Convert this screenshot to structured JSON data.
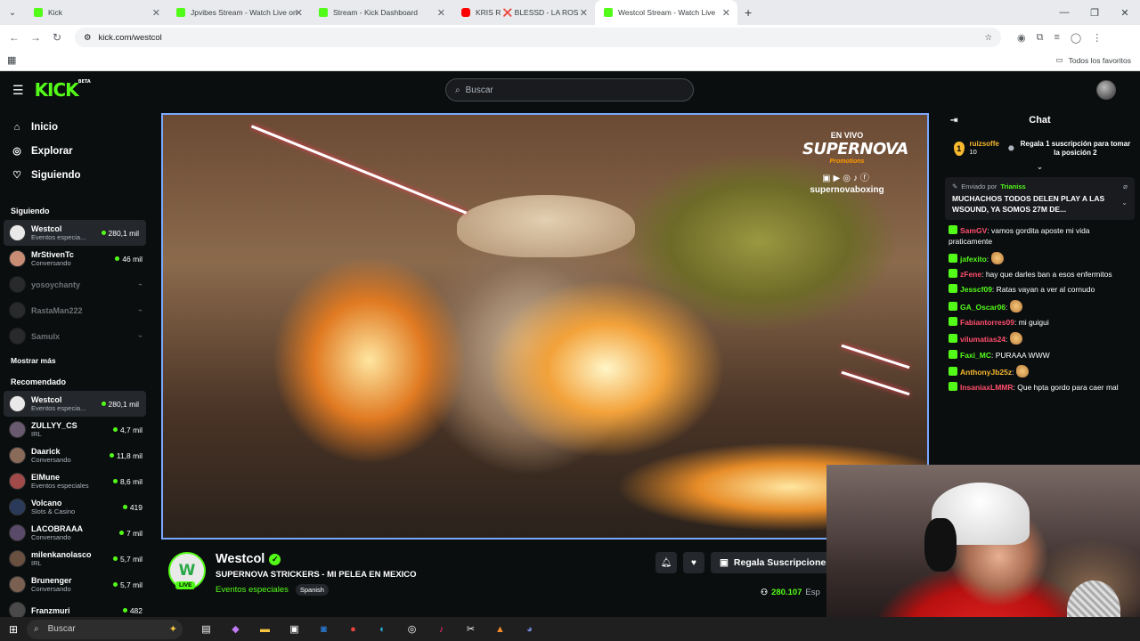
{
  "browser": {
    "tabs": [
      {
        "title": "Kick",
        "favicon": "kick-icon",
        "active": false
      },
      {
        "title": "Jpvibes Stream - Watch Live on",
        "favicon": "kick-icon",
        "active": false
      },
      {
        "title": "Stream - Kick Dashboard",
        "favicon": "kick-icon",
        "active": false
      },
      {
        "title": "KRIS R ❌ BLESSD - LA ROS",
        "favicon": "youtube-icon",
        "active": false
      },
      {
        "title": "Westcol Stream - Watch Live",
        "favicon": "kick-icon",
        "active": true
      }
    ],
    "url": "kick.com/westcol",
    "bookmarks_label": "Todos los favoritos"
  },
  "header": {
    "logo_text": "KICK",
    "logo_badge": "BETA",
    "search_placeholder": "Buscar"
  },
  "sidebar": {
    "nav": [
      {
        "label": "Inicio",
        "icon": "home-icon"
      },
      {
        "label": "Explorar",
        "icon": "compass-icon"
      },
      {
        "label": "Siguiendo",
        "icon": "heart-icon"
      }
    ],
    "following_title": "Siguiendo",
    "following": [
      {
        "name": "Westcol",
        "sub": "Eventos especia...",
        "viewers": "280,1 mil",
        "live": true
      },
      {
        "name": "MrStivenTc",
        "sub": "Conversando",
        "viewers": "46 mil",
        "live": true
      },
      {
        "name": "yosoychanty",
        "sub": "",
        "viewers": "",
        "live": false
      },
      {
        "name": "RastaMan222",
        "sub": "",
        "viewers": "",
        "live": false
      },
      {
        "name": "Samulx",
        "sub": "",
        "viewers": "",
        "live": false
      }
    ],
    "show_more": "Mostrar más",
    "recommended_title": "Recomendado",
    "recommended": [
      {
        "name": "Westcol",
        "sub": "Eventos especia...",
        "viewers": "280,1 mil"
      },
      {
        "name": "ZULLYY_CS",
        "sub": "IRL",
        "viewers": "4,7 mil"
      },
      {
        "name": "Daarick",
        "sub": "Conversando",
        "viewers": "11,8 mil"
      },
      {
        "name": "ElMune",
        "sub": "Eventos especiales",
        "viewers": "8,6 mil"
      },
      {
        "name": "Volcano",
        "sub": "Slots & Casino",
        "viewers": "419"
      },
      {
        "name": "LACOBRAAA",
        "sub": "Conversando",
        "viewers": "7 mil"
      },
      {
        "name": "milenkanolasco",
        "sub": "IRL",
        "viewers": "5,7 mil"
      },
      {
        "name": "Brunenger",
        "sub": "Conversando",
        "viewers": "5,7 mil"
      },
      {
        "name": "Franzmuri",
        "sub": "",
        "viewers": "482"
      }
    ]
  },
  "player": {
    "overlay_live": "EN VIVO",
    "overlay_brand": "SUPERNOVA",
    "overlay_brand_sub": "Promotions",
    "overlay_handle": "supernovaboxing"
  },
  "stream": {
    "channel": "Westcol",
    "avatar_text": "W",
    "live_badge": "LIVE",
    "title": "SUPERNOVA STRICKERS - MI PELEA EN MEXICO",
    "category": "Eventos especiales",
    "language": "Spanish",
    "subscribe_label": "Regala Suscripciones",
    "viewers": "280.107",
    "viewers_suffix": "Esp"
  },
  "chat": {
    "title": "Chat",
    "gifter": {
      "rank": "1",
      "name": "ruizsoffe",
      "count": "10"
    },
    "gift_cta": "Regala 1 suscripción para tomar la posición 2",
    "pinned": {
      "by_label": "Enviado por",
      "by_user": "Trianiss",
      "message": "MUCHACHOS TODOS DELEN PLAY A LAS WSOUND, YA SOMOS 27M DE..."
    },
    "messages": [
      {
        "user": "SamGV",
        "color": "#ff4f6d",
        "text": "vamos gordita aposte mi vida praticamente",
        "emote": false
      },
      {
        "user": "jafexito",
        "color": "#53fc18",
        "text": "",
        "emote": true
      },
      {
        "user": "zFene",
        "color": "#ff4f6d",
        "text": "hay que darles ban a esos enfermitos",
        "emote": false
      },
      {
        "user": "Jesscf09",
        "color": "#53fc18",
        "text": "Ratas vayan a ver al cornudo",
        "emote": false
      },
      {
        "user": "GA_Oscar06",
        "color": "#53fc18",
        "text": "",
        "emote": true
      },
      {
        "user": "Fabiantorres09",
        "color": "#ff4f6d",
        "text": "mi guigui",
        "emote": false
      },
      {
        "user": "vilumatias24",
        "color": "#ff4f6d",
        "text": "",
        "emote": true
      },
      {
        "user": "Faxi_MC",
        "color": "#53fc18",
        "text": "PURAAA WWW",
        "emote": false
      },
      {
        "user": "AnthonyJb25z",
        "color": "#f5b82e",
        "text": "",
        "emote": true
      },
      {
        "user": "InsaniaxLMMR",
        "color": "#ff4f6d",
        "text": "Que hpta gordo para caer mal",
        "emote": false
      }
    ]
  },
  "taskbar": {
    "search_label": "Buscar"
  },
  "colors": {
    "kick_green": "#53fc18",
    "background": "#0b0e0f",
    "panel": "#191b1f"
  }
}
